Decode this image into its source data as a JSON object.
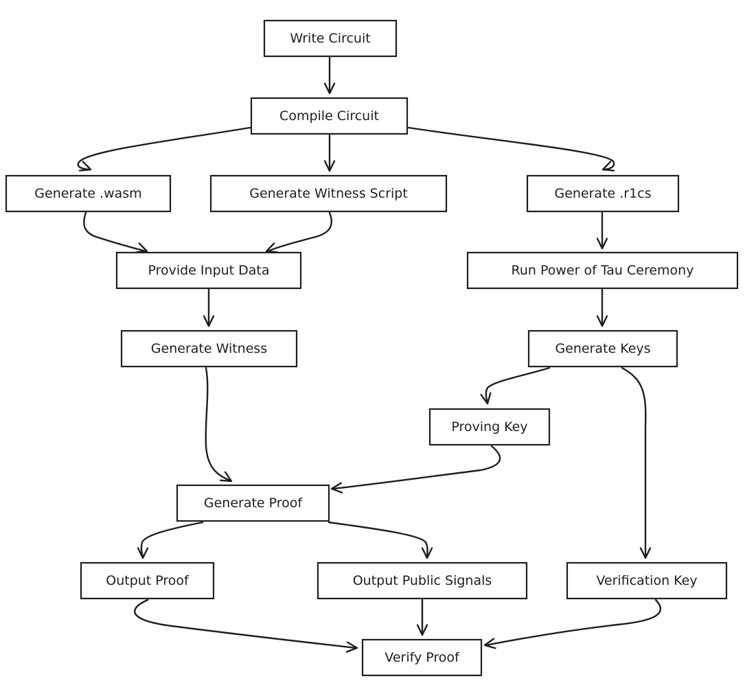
{
  "diagram": {
    "nodes": [
      {
        "id": "write",
        "label": "Write Circuit"
      },
      {
        "id": "compile",
        "label": "Compile Circuit"
      },
      {
        "id": "wasm",
        "label": "Generate .wasm"
      },
      {
        "id": "wscript",
        "label": "Generate Witness Script"
      },
      {
        "id": "r1cs",
        "label": "Generate .r1cs"
      },
      {
        "id": "input",
        "label": "Provide Input Data"
      },
      {
        "id": "tau",
        "label": "Run Power of Tau Ceremony"
      },
      {
        "id": "witness",
        "label": "Generate Witness"
      },
      {
        "id": "keys",
        "label": "Generate Keys"
      },
      {
        "id": "pkey",
        "label": "Proving Key"
      },
      {
        "id": "proof",
        "label": "Generate Proof"
      },
      {
        "id": "oproof",
        "label": "Output Proof"
      },
      {
        "id": "signals",
        "label": "Output Public Signals"
      },
      {
        "id": "vkey",
        "label": "Verification Key"
      },
      {
        "id": "verify",
        "label": "Verify Proof"
      }
    ],
    "edges": [
      {
        "from": "write",
        "to": "compile"
      },
      {
        "from": "compile",
        "to": "wasm"
      },
      {
        "from": "compile",
        "to": "wscript"
      },
      {
        "from": "compile",
        "to": "r1cs"
      },
      {
        "from": "wasm",
        "to": "input"
      },
      {
        "from": "wscript",
        "to": "input"
      },
      {
        "from": "r1cs",
        "to": "tau"
      },
      {
        "from": "input",
        "to": "witness"
      },
      {
        "from": "tau",
        "to": "keys"
      },
      {
        "from": "keys",
        "to": "pkey"
      },
      {
        "from": "keys",
        "to": "vkey"
      },
      {
        "from": "witness",
        "to": "proof"
      },
      {
        "from": "pkey",
        "to": "proof"
      },
      {
        "from": "proof",
        "to": "oproof"
      },
      {
        "from": "proof",
        "to": "signals"
      },
      {
        "from": "oproof",
        "to": "verify"
      },
      {
        "from": "signals",
        "to": "verify"
      },
      {
        "from": "vkey",
        "to": "verify"
      }
    ]
  }
}
